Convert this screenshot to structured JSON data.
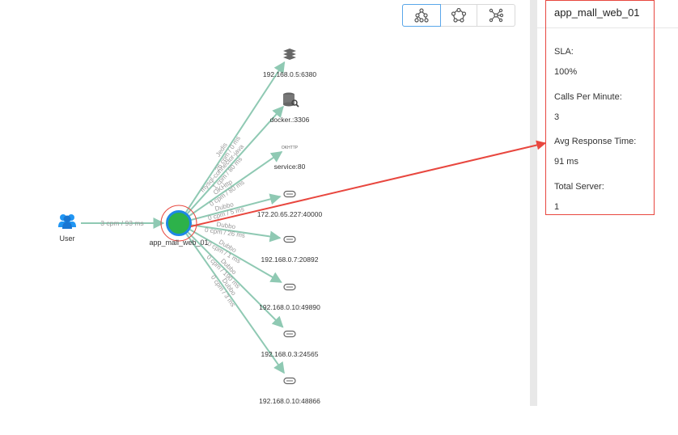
{
  "topology": {
    "user_node": {
      "label": "User",
      "edge_label": "3 cpm / 93 ms"
    },
    "center_node": {
      "label": "app_mall_web_01",
      "color": "#2db24a",
      "ring_color": "#1e88e5"
    },
    "edge_color": "#8fc9b3",
    "targets": [
      {
        "label": "192.168.0.5:6380",
        "icon": "redis-icon",
        "edge_lines": [
          "Jedis",
          "26 cpm / 0 ms"
        ]
      },
      {
        "label": "docker.:3306",
        "icon": "database-icon",
        "edge_lines": [
          "mysql-connector-java",
          "1 cpm / 80 ms"
        ]
      },
      {
        "label": "service:80",
        "icon": "http-icon",
        "icon_text": "OKHTTP",
        "edge_lines": [
          "OKHttp",
          "0 cpm / 80 ms"
        ]
      },
      {
        "label": "172.20.65.227:40000",
        "icon": "dubbo-icon",
        "edge_lines": [
          "Dubbo",
          "0 cpm / 5 ms"
        ]
      },
      {
        "label": "192.168.0.7:20892",
        "icon": "dubbo-icon",
        "edge_lines": [
          "Dubbo",
          "0 cpm / 26 ms"
        ]
      },
      {
        "label": "192.168.0.10:49890",
        "icon": "dubbo-icon",
        "edge_lines": [
          "Dubbo",
          "0 cpm / 1 ms"
        ]
      },
      {
        "label": "192.168.0.3:24565",
        "icon": "dubbo-icon",
        "edge_lines": [
          "Dubbo",
          "0 cpm / 190 ms"
        ]
      },
      {
        "label": "192.168.0.10:48866",
        "icon": "dubbo-icon",
        "edge_lines": [
          "Dubbo",
          "0 cpm / 3 ms"
        ]
      }
    ]
  },
  "layout_switch": {
    "options": [
      "tree-layout-icon",
      "circle-layout-icon",
      "radial-layout-icon"
    ],
    "active": "tree-layout-icon"
  },
  "panel": {
    "title": "app_mall_web_01",
    "sla_label": "SLA:",
    "sla_value": "100%",
    "cpm_label": "Calls Per Minute:",
    "cpm_value": "3",
    "avg_label": "Avg Response Time:",
    "avg_value": "91 ms",
    "server_label": "Total Server:",
    "server_value": "1"
  },
  "annotation_color": "#e8473f"
}
